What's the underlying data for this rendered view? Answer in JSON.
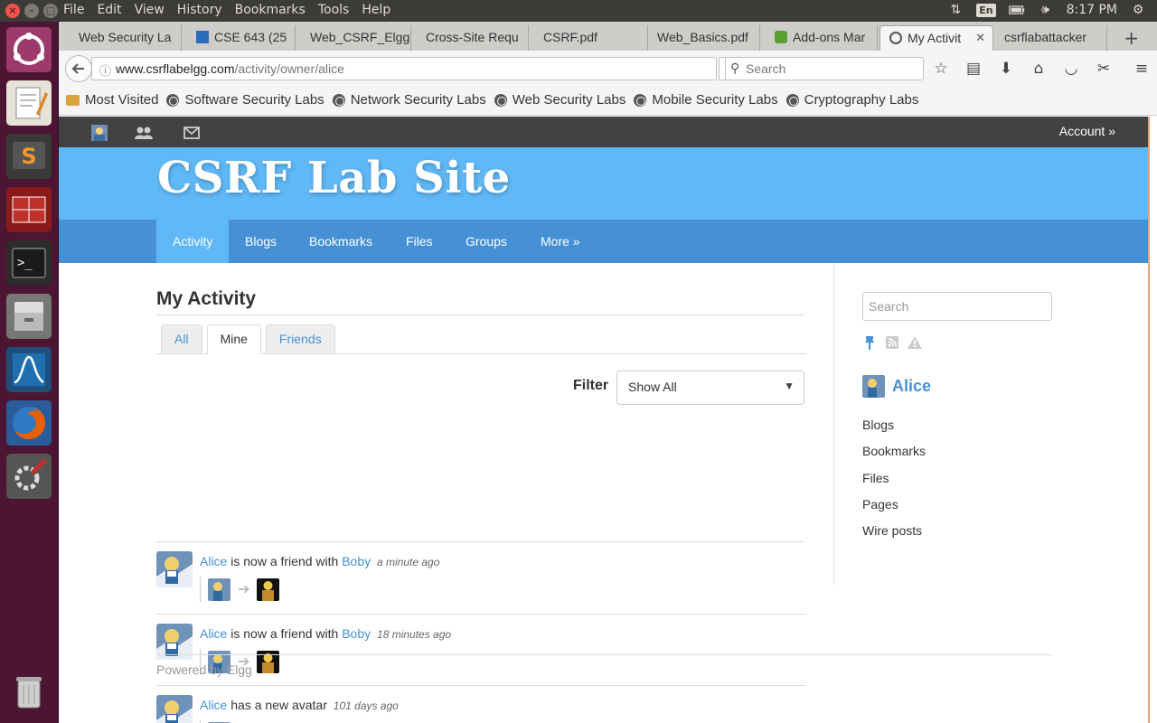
{
  "system": {
    "menus": [
      "File",
      "Edit",
      "View",
      "History",
      "Bookmarks",
      "Tools",
      "Help"
    ],
    "lang": "En",
    "clock": "8:17 PM"
  },
  "browser": {
    "tabs": [
      {
        "label": "Web Security La"
      },
      {
        "label": "CSE 643 (25"
      },
      {
        "label": "Web_CSRF_Elgg"
      },
      {
        "label": "Cross-Site Requ"
      },
      {
        "label": "CSRF.pdf"
      },
      {
        "label": "Web_Basics.pdf"
      },
      {
        "label": "Add-ons Mar"
      },
      {
        "label": "My Activit"
      },
      {
        "label": "csrflabattacker"
      }
    ],
    "url_host": "www.csrflabelgg.com",
    "url_path": "/activity/owner/alice",
    "search_placeholder": "Search",
    "bookmarks": [
      "Most Visited",
      "Software Security Labs",
      "Network Security Labs",
      "Web Security Labs",
      "Mobile Security Labs",
      "Cryptography Labs"
    ]
  },
  "site": {
    "account_label": "Account »",
    "title": "CSRF Lab Site",
    "nav": [
      "Activity",
      "Blogs",
      "Bookmarks",
      "Files",
      "Groups",
      "More »"
    ],
    "page_title": "My Activity",
    "tabs": [
      "All",
      "Mine",
      "Friends"
    ],
    "filter_label": "Filter",
    "filter_value": "Show All",
    "river": [
      {
        "subject": "Alice",
        "verb": "is now a friend with",
        "object": "Boby",
        "time": "a minute ago"
      },
      {
        "subject": "Alice",
        "verb": "is now a friend with",
        "object": "Boby",
        "time": "18 minutes ago"
      },
      {
        "subject": "Alice",
        "verb": "has a new avatar",
        "object": "",
        "time": "101 days ago"
      }
    ],
    "sidebar": {
      "search_placeholder": "Search",
      "owner_name": "Alice",
      "menu": [
        "Blogs",
        "Bookmarks",
        "Files",
        "Pages",
        "Wire posts"
      ]
    },
    "footer": "Powered by Elgg"
  },
  "colors": {
    "header_blue": "#60b8f7",
    "nav_blue": "#4690d6",
    "topbar": "#424242",
    "launcher": "#4b1533"
  }
}
